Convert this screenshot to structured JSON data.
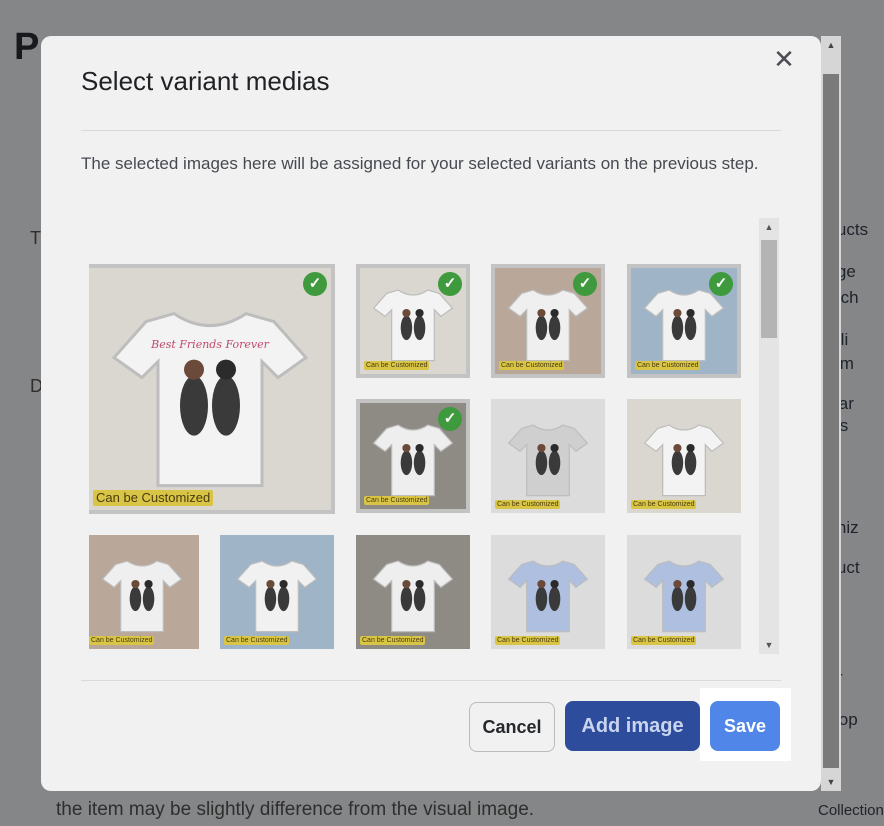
{
  "background": {
    "title": "P",
    "mid_text_1": "T",
    "mid_text_2": "D",
    "right_texts": [
      "oducts",
      "nage",
      "se ch",
      "Onli",
      "Hom",
      "Sear",
      "files",
      "ganiz",
      "oduct",
      "dor",
      "Shop",
      "Collection"
    ],
    "bottom_text": "the item may be slightly difference from the visual image."
  },
  "modal": {
    "title": "Select variant medias",
    "close_glyph": "✕",
    "description": "The selected images here will be assigned for your selected variants on the previous step.",
    "badge_text": "Can be Customized",
    "shirt_caption": "Best Friends Forever",
    "check_glyph": "✓",
    "images": [
      {
        "selected": true,
        "variant": "white-flat"
      },
      {
        "selected": true,
        "variant": "white-flat"
      },
      {
        "selected": true,
        "variant": "couple"
      },
      {
        "selected": true,
        "variant": "city-woman"
      },
      {
        "selected": true,
        "variant": "man"
      },
      {
        "selected": false,
        "variant": "gray-flat"
      },
      {
        "selected": false,
        "variant": "white-flat"
      },
      {
        "selected": false,
        "variant": "couple"
      },
      {
        "selected": false,
        "variant": "city-woman"
      },
      {
        "selected": false,
        "variant": "man"
      },
      {
        "selected": false,
        "variant": "blue-flat"
      },
      {
        "selected": false,
        "variant": "blue-flat"
      },
      {
        "selected": false,
        "variant": "couple"
      },
      {
        "selected": false,
        "variant": "city-woman"
      },
      {
        "selected": false,
        "variant": "man"
      },
      {
        "selected": false,
        "variant": "pink-flat"
      },
      {
        "selected": false,
        "variant": "pink-flat"
      }
    ],
    "buttons": {
      "cancel": "Cancel",
      "add_image": "Add image",
      "save": "Save"
    }
  },
  "colors": {
    "save": "#4f86e8",
    "add_image": "#2e4c9c",
    "check": "#3e9a3d"
  }
}
